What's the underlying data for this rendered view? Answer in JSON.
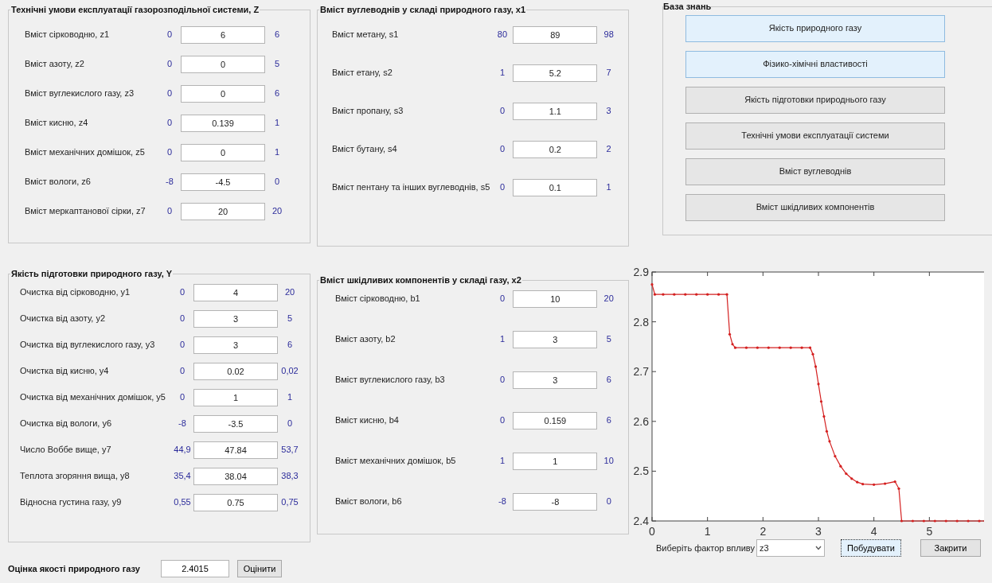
{
  "panels": [
    {
      "title": "Технічні умови експлуатації газорозподільної системи, Z",
      "rows": [
        {
          "label": "Вміст сірководню, z1",
          "min": "0",
          "value": "6",
          "max": "6"
        },
        {
          "label": "Вміст азоту, z2",
          "min": "0",
          "value": "0",
          "max": "5"
        },
        {
          "label": "Вміст вуглекислого газу, z3",
          "min": "0",
          "value": "0",
          "max": "6"
        },
        {
          "label": "Вміст кисню, z4",
          "min": "0",
          "value": "0.139",
          "max": "1"
        },
        {
          "label": "Вміст механічних домішок, z5",
          "min": "0",
          "value": "0",
          "max": "1"
        },
        {
          "label": "Вміст вологи, z6",
          "min": "-8",
          "value": "-4.5",
          "max": "0"
        },
        {
          "label": "Вміст меркаптанової сірки, z7",
          "min": "0",
          "value": "20",
          "max": "20"
        }
      ]
    },
    {
      "title": "Вміст вуглеводнів у складі природного газу, x1",
      "rows": [
        {
          "label": "Вміст метану, s1",
          "min": "80",
          "value": "89",
          "max": "98"
        },
        {
          "label": "Вміст етану, s2",
          "min": "1",
          "value": "5.2",
          "max": "7"
        },
        {
          "label": "Вміст пропану, s3",
          "min": "0",
          "value": "1.1",
          "max": "3"
        },
        {
          "label": "Вміст бутану, s4",
          "min": "0",
          "value": "0.2",
          "max": "2"
        },
        {
          "label": "Вміст пентану та інших вуглеводнів, s5",
          "min": "0",
          "value": "0.1",
          "max": "1"
        }
      ]
    },
    {
      "title": "Якість підготовки природного газу, Y",
      "rows": [
        {
          "label": "Очистка від сірководню, y1",
          "min": "0",
          "value": "4",
          "max": "20"
        },
        {
          "label": "Очистка від азоту, y2",
          "min": "0",
          "value": "3",
          "max": "5"
        },
        {
          "label": "Очистка від вуглекислого газу, y3",
          "min": "0",
          "value": "3",
          "max": "6"
        },
        {
          "label": "Очистка від кисню, y4",
          "min": "0",
          "value": "0.02",
          "max": "0,02"
        },
        {
          "label": "Очистка від механічних домішок, y5",
          "min": "0",
          "value": "1",
          "max": "1"
        },
        {
          "label": "Очистка від вологи, y6",
          "min": "-8",
          "value": "-3.5",
          "max": "0"
        },
        {
          "label": "Число Воббе вище, y7",
          "min": "44,9",
          "value": "47.84",
          "max": "53,7"
        },
        {
          "label": "Теплота згоряння вища, y8",
          "min": "35,4",
          "value": "38.04",
          "max": "38,3"
        },
        {
          "label": "Відносна густина газу, y9",
          "min": "0,55",
          "value": "0.75",
          "max": "0,75"
        }
      ]
    },
    {
      "title": "Вміст шкідливих компонентів у складі газу, x2",
      "rows": [
        {
          "label": "Вміст сірководню, b1",
          "min": "0",
          "value": "10",
          "max": "20"
        },
        {
          "label": "Вміст азоту, b2",
          "min": "1",
          "value": "3",
          "max": "5"
        },
        {
          "label": "Вміст вуглекислого газу, b3",
          "min": "0",
          "value": "3",
          "max": "6"
        },
        {
          "label": "Вміст кисню, b4",
          "min": "0",
          "value": "0.159",
          "max": "6"
        },
        {
          "label": "Вміст механічних домішок, b5",
          "min": "1",
          "value": "1",
          "max": "10"
        },
        {
          "label": "Вміст вологи, b6",
          "min": "-8",
          "value": "-8",
          "max": "0"
        }
      ]
    }
  ],
  "knowledge_base": {
    "title": "База знань",
    "buttons": [
      {
        "label": "Якість природного газу",
        "selected": true
      },
      {
        "label": "Фізико-хімічні властивості",
        "selected": true
      },
      {
        "label": "Якість підготовки природнього газу",
        "selected": false
      },
      {
        "label": "Технічні умови експлуатації системи",
        "selected": false
      },
      {
        "label": "Вміст вуглеводнів",
        "selected": false
      },
      {
        "label": "Вміст шкідливих компонентів",
        "selected": false
      }
    ]
  },
  "assessment": {
    "label": "Оцінка якості природного газу",
    "value": "2.4015",
    "button": "Оцінити"
  },
  "chart_data": {
    "type": "line",
    "xlim": [
      0,
      6
    ],
    "ylim": [
      2.4,
      2.9
    ],
    "xticks": [
      0,
      1,
      2,
      3,
      4,
      5
    ],
    "yticks": [
      2.4,
      2.5,
      2.6,
      2.7,
      2.8,
      2.9
    ],
    "x": [
      0,
      0.05,
      0.2,
      0.4,
      0.6,
      0.8,
      1.0,
      1.2,
      1.35,
      1.4,
      1.45,
      1.5,
      1.7,
      1.9,
      2.1,
      2.3,
      2.5,
      2.7,
      2.85,
      2.9,
      2.95,
      3.0,
      3.05,
      3.1,
      3.15,
      3.2,
      3.3,
      3.4,
      3.5,
      3.6,
      3.7,
      3.8,
      4.0,
      4.2,
      4.38,
      4.45,
      4.5,
      4.7,
      4.9,
      5.1,
      5.3,
      5.5,
      5.7,
      5.9,
      6.0
    ],
    "series": [
      {
        "color": "#d42020",
        "values": [
          2.875,
          2.855,
          2.855,
          2.855,
          2.855,
          2.855,
          2.855,
          2.855,
          2.855,
          2.775,
          2.755,
          2.748,
          2.748,
          2.748,
          2.748,
          2.748,
          2.748,
          2.748,
          2.748,
          2.735,
          2.71,
          2.675,
          2.64,
          2.61,
          2.58,
          2.56,
          2.53,
          2.51,
          2.495,
          2.485,
          2.478,
          2.474,
          2.473,
          2.475,
          2.479,
          2.465,
          2.4,
          2.4,
          2.4,
          2.4,
          2.4,
          2.4,
          2.4,
          2.4,
          2.4
        ]
      }
    ]
  },
  "factor": {
    "label": "Виберіть фактор впливу",
    "value": "z3",
    "build_button": "Побудувати",
    "build_focused": true,
    "close_button": "Закрити"
  }
}
